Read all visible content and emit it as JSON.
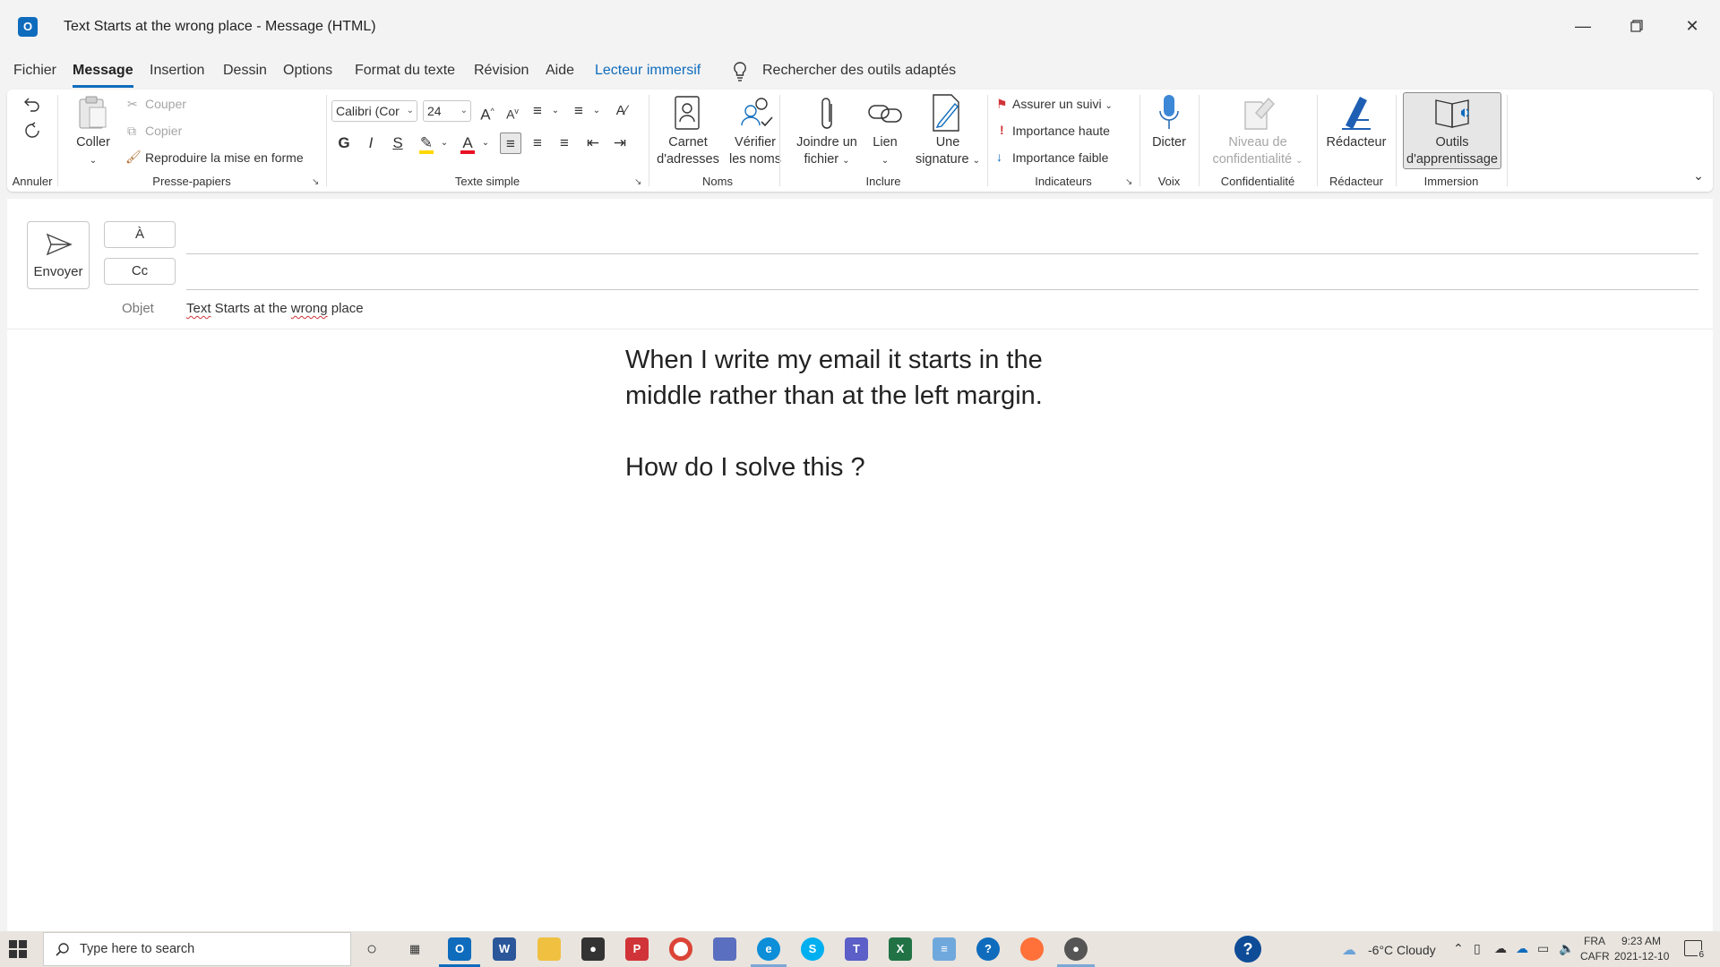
{
  "window": {
    "title": "Text Starts at the wrong place  -  Message (HTML)",
    "app_icon_letter": "O",
    "controls": [
      "minimize-icon",
      "restore-icon",
      "close-icon"
    ]
  },
  "menu_tabs": [
    "Fichier",
    "Message",
    "Insertion",
    "Dessin",
    "Options",
    "Format du texte",
    "Révision",
    "Aide",
    "Lecteur immersif"
  ],
  "active_tab": "Message",
  "tell_me": "Rechercher des outils adaptés",
  "ribbon": {
    "annuler": {
      "label": "Annuler"
    },
    "presse_papiers": {
      "label": "Presse-papiers",
      "coller": "Coller",
      "couper": "Couper",
      "copier": "Copier",
      "reproduire": "Reproduire la mise en forme"
    },
    "texte_simple": {
      "label": "Texte simple",
      "font": "Calibri (Cor",
      "size": "24",
      "bold": "G",
      "italic": "I",
      "strike": "S"
    },
    "noms": {
      "label": "Noms",
      "carnet_1": "Carnet",
      "carnet_2": "d'adresses",
      "verifier_1": "Vérifier",
      "verifier_2": "les noms"
    },
    "inclure": {
      "label": "Inclure",
      "joindre_1": "Joindre un",
      "joindre_2": "fichier",
      "lien": "Lien",
      "signature_1": "Une",
      "signature_2": "signature"
    },
    "indicateurs": {
      "label": "Indicateurs",
      "suivi": "Assurer un suivi",
      "haute": "Importance haute",
      "faible": "Importance faible"
    },
    "voix": {
      "label": "Voix",
      "dicter": "Dicter"
    },
    "confidentialite": {
      "label": "Confidentialité",
      "niveau_1": "Niveau de",
      "niveau_2": "confidentialité"
    },
    "redacteur": {
      "label": "Rédacteur",
      "btn": "Rédacteur"
    },
    "immersion": {
      "label": "Immersion",
      "outils_1": "Outils",
      "outils_2": "d'apprentissage"
    }
  },
  "compose": {
    "send": "Envoyer",
    "to": "À",
    "cc": "Cc",
    "subject_label": "Objet",
    "subject_w1": "Text",
    "subject_w2": " Starts at the ",
    "subject_w3": "wrong",
    "subject_w4": " place",
    "body_line1": "When I write my email it starts in the",
    "body_line2": "middle rather than at the left margin.",
    "body_line3": "How do I solve this ?"
  },
  "taskbar": {
    "search_placeholder": "Type here to search",
    "weather": "-6°C  Cloudy",
    "lang1": "FRA",
    "lang2": "CAFR",
    "time": "9:23 AM",
    "date": "2021-12-10",
    "notif_count": "6"
  },
  "colors": {
    "accent": "#0f6cbd",
    "flag_red": "#d13438",
    "highlight_yellow": "#ffd800",
    "font_color_red": "#e81123"
  }
}
